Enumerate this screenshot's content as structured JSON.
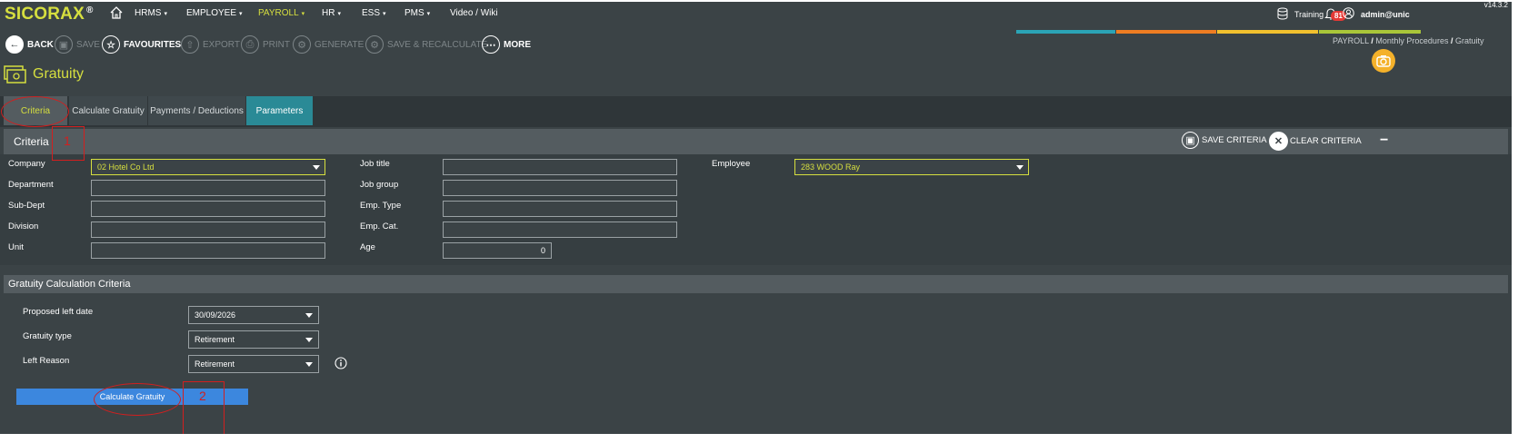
{
  "app": {
    "logo": "SICORAX",
    "registered": "®",
    "version": "v14.3.2"
  },
  "nav": {
    "home": "home-icon",
    "items": [
      {
        "label": "HRMS",
        "caret": "▾"
      },
      {
        "label": "EMPLOYEE",
        "caret": "▾"
      },
      {
        "label": "PAYROLL",
        "caret": "▾"
      },
      {
        "label": "HR",
        "caret": "▾"
      },
      {
        "label": "ESS",
        "caret": "▾"
      },
      {
        "label": "PMS",
        "caret": "▾"
      },
      {
        "label": "Video / Wiki",
        "caret": ""
      }
    ],
    "active": "PAYROLL",
    "notifications": "81",
    "database": "Training",
    "user": "admin@unic"
  },
  "toolbar": {
    "back": "BACK",
    "save": "SAVE",
    "favourites": "FAVOURITES",
    "export": "EXPORT",
    "print": "PRINT",
    "generate": "GENERATE",
    "save_recalculate": "SAVE & RECALCULATE",
    "more": "MORE"
  },
  "colors": {
    "accent": "#d6df3f",
    "teal": "#2a8a96",
    "bars": [
      "#2ba4b6",
      "#ef7d22",
      "#f2c12e",
      "#a9c639"
    ],
    "button": "#3c87de",
    "annotation": "#d21f1f"
  },
  "breadcrumb": {
    "part1": "PAYROLL",
    "sep": "/",
    "part2": "Monthly Procedures",
    "part3": "Gratuity"
  },
  "page": {
    "title": "Gratuity"
  },
  "tabs": [
    "Criteria",
    "Calculate Gratuity",
    "Payments / Deductions",
    "Parameters"
  ],
  "criteria": {
    "title": "Criteria",
    "save_criteria": "SAVE CRITERIA",
    "clear_criteria": "CLEAR CRITERIA",
    "collapse": "−",
    "labels": {
      "company": "Company",
      "department": "Department",
      "sub_dept": "Sub-Dept",
      "division": "Division",
      "unit": "Unit",
      "job_title": "Job title",
      "job_group": "Job group",
      "emp_type": "Emp. Type",
      "emp_cat": "Emp. Cat.",
      "age": "Age",
      "employee": "Employee"
    },
    "values": {
      "company": "02 Hotel Co Ltd",
      "age": "0",
      "employee": "283 WOOD Ray"
    }
  },
  "gratuity": {
    "title": "Gratuity Calculation Criteria",
    "labels": {
      "proposed_left_date": "Proposed left date",
      "gratuity_type": "Gratuity type",
      "left_reason": "Left Reason"
    },
    "values": {
      "proposed_left_date": "30/09/2026",
      "gratuity_type": "Retirement",
      "left_reason": "Retirement"
    },
    "button": "Calculate Gratuity"
  },
  "annotations": {
    "one": "1",
    "two": "2"
  }
}
